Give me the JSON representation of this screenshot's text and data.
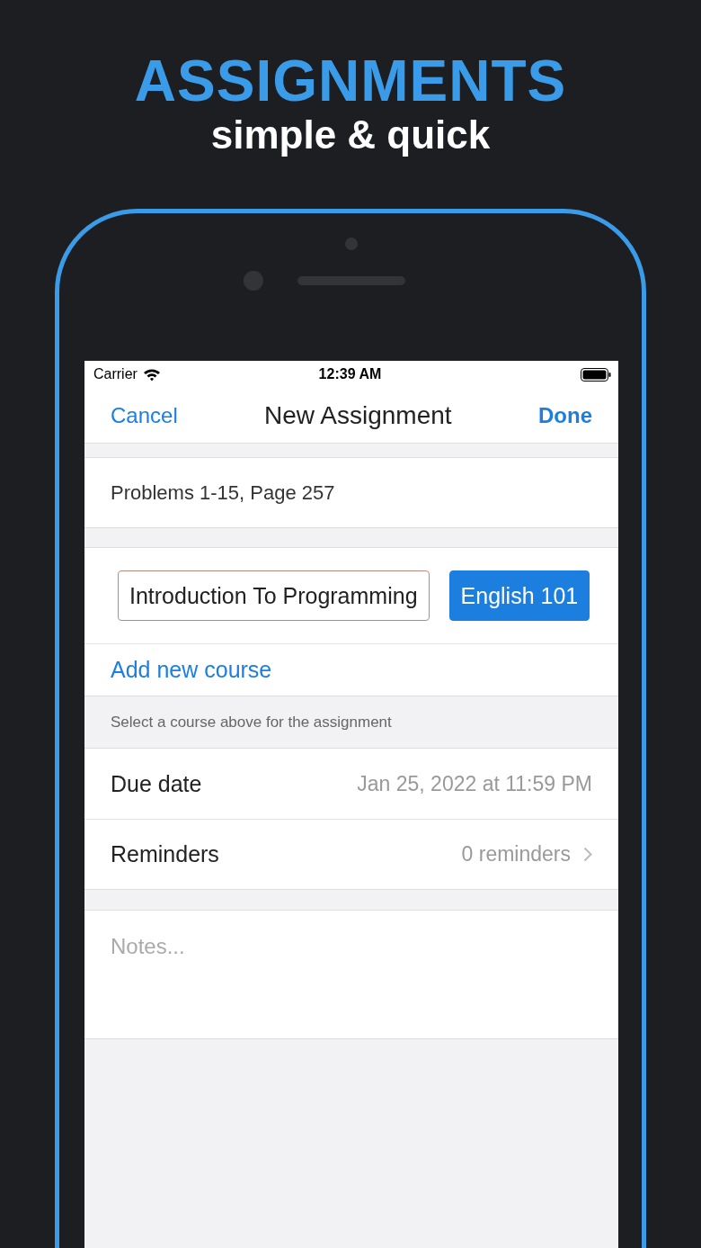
{
  "header": {
    "title": "ASSIGNMENTS",
    "subtitle": "simple & quick"
  },
  "status_bar": {
    "carrier": "Carrier",
    "time": "12:39 AM"
  },
  "nav_bar": {
    "cancel": "Cancel",
    "title": "New Assignment",
    "done": "Done"
  },
  "assignment_title": {
    "value": "Problems 1-15, Page 257"
  },
  "courses": [
    {
      "name": "Introduction To Programming",
      "selected": false
    },
    {
      "name": "English 101",
      "selected": true
    }
  ],
  "add_course": "Add new course",
  "course_hint": "Select a course above for the assignment",
  "rows": [
    {
      "kind": "value",
      "label": "Due date",
      "value": "Jan 25, 2022 at 11:59 PM"
    },
    {
      "kind": "disclosure",
      "label": "Reminders",
      "value": "0 reminders"
    }
  ],
  "notes": {
    "placeholder": "Notes..."
  }
}
